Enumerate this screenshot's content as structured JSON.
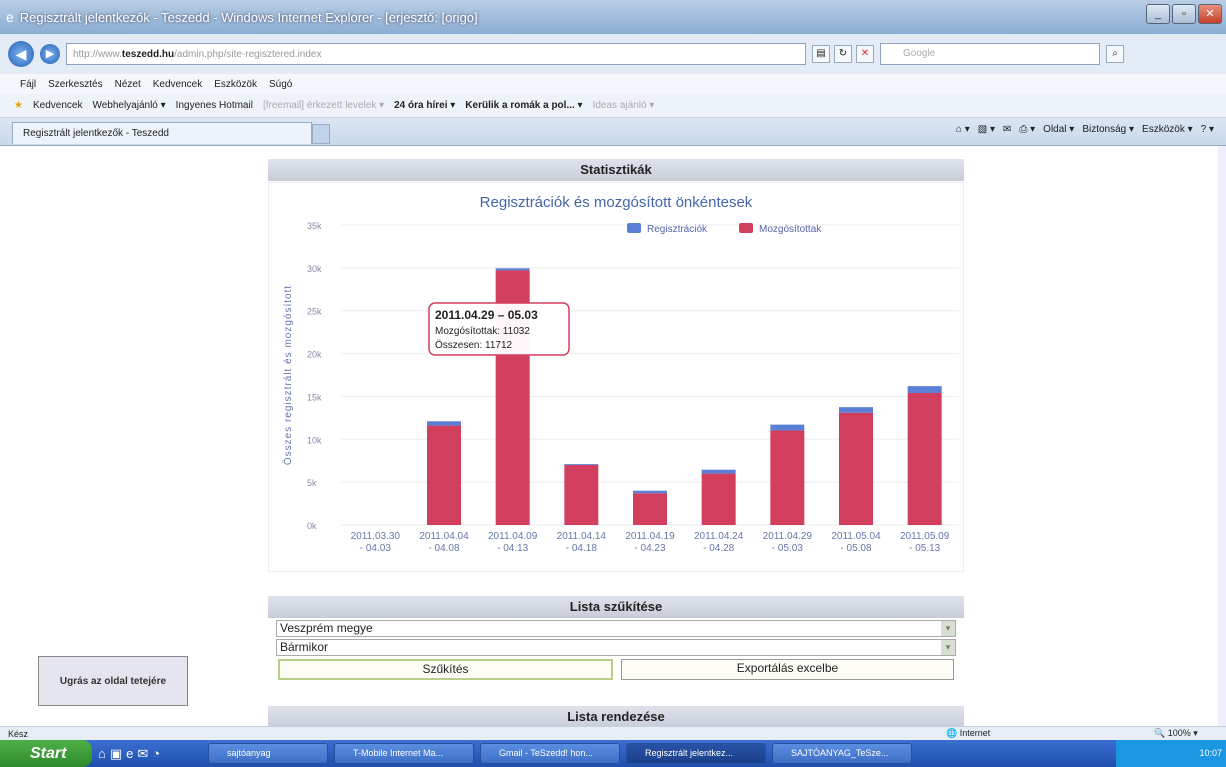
{
  "window": {
    "title": "Regisztrált jelentkezők - Teszedd - Windows Internet Explorer - [erjesztő: [origo]"
  },
  "address": {
    "url_pre": "http://www.",
    "url_domain": "teszedd.hu",
    "url_rest": "/admin.php/site-regisztered.index",
    "search_placeholder": "Google"
  },
  "menu": [
    "Fájl",
    "Szerkesztés",
    "Nézet",
    "Kedvencek",
    "Eszközök",
    "Súgó"
  ],
  "favorites": {
    "label": "Kedvencek",
    "items": [
      "Webhelyajánló ▾",
      "Ingyenes Hotmail",
      "[freemail] érkezett levelek ▾",
      "24 óra hírei ▾",
      "Kerülik a romák a pol... ▾",
      "Ideas ajánló ▾"
    ]
  },
  "tab": {
    "title": "Regisztrált jelentkezők - Teszedd"
  },
  "commands": [
    "Oldal ▾",
    "Biztonság ▾",
    "Eszközök ▾"
  ],
  "panels": {
    "stats_title": "Statisztikák",
    "filter_title": "Lista szűkítése",
    "order_title": "Lista rendezése"
  },
  "filters": {
    "county": "Veszprém megye",
    "time": "Bármikor",
    "narrow_button": "Szűkítés",
    "export_button": "Exportálás excelbe"
  },
  "jump_button": "Ugrás az oldal tetejére",
  "status": {
    "left": "Kész",
    "zone": "Internet",
    "zoom": "100%"
  },
  "taskbar": {
    "start": "Start",
    "items": [
      "sajtóanyag",
      "T-Mobile Internet Ma...",
      "Gmail - TeSzedd! hon...",
      "Regisztrált jelentkez...",
      "SAJTÓANYAG_TeSze..."
    ],
    "clock": "10:07"
  },
  "chart_data": {
    "type": "bar",
    "stacked": true,
    "title": "Regisztrációk és mozgósított önkéntesek",
    "ylabel": "Összes regisztrált és mozgósított",
    "ylim": [
      0,
      35000
    ],
    "yticks": [
      "0k",
      "5k",
      "10k",
      "15k",
      "20k",
      "25k",
      "30k",
      "35k"
    ],
    "legend_position": "top-right",
    "categories": [
      "2011.03.30 - 04.03",
      "2011.04.04 - 04.08",
      "2011.04.09 - 04.13",
      "2011.04.14 - 04.18",
      "2011.04.19 - 04.23",
      "2011.04.24 - 04.28",
      "2011.04.29 - 05.03",
      "2011.05.04 - 05.08",
      "2011.05.09 - 05.13"
    ],
    "series": [
      {
        "name": "Regisztrációk",
        "color": "#5b7fd6",
        "values": [
          0,
          500,
          250,
          100,
          300,
          450,
          680,
          650,
          800
        ]
      },
      {
        "name": "Mozgósítottak",
        "color": "#d23f5e",
        "values": [
          0,
          11600,
          29700,
          7000,
          3700,
          6000,
          11032,
          13100,
          15400
        ]
      }
    ],
    "tooltip": {
      "title": "2011.04.29 – 05.03",
      "line1": "Mozgósítottak: 11032",
      "line2": "Összesen: 11712"
    }
  }
}
